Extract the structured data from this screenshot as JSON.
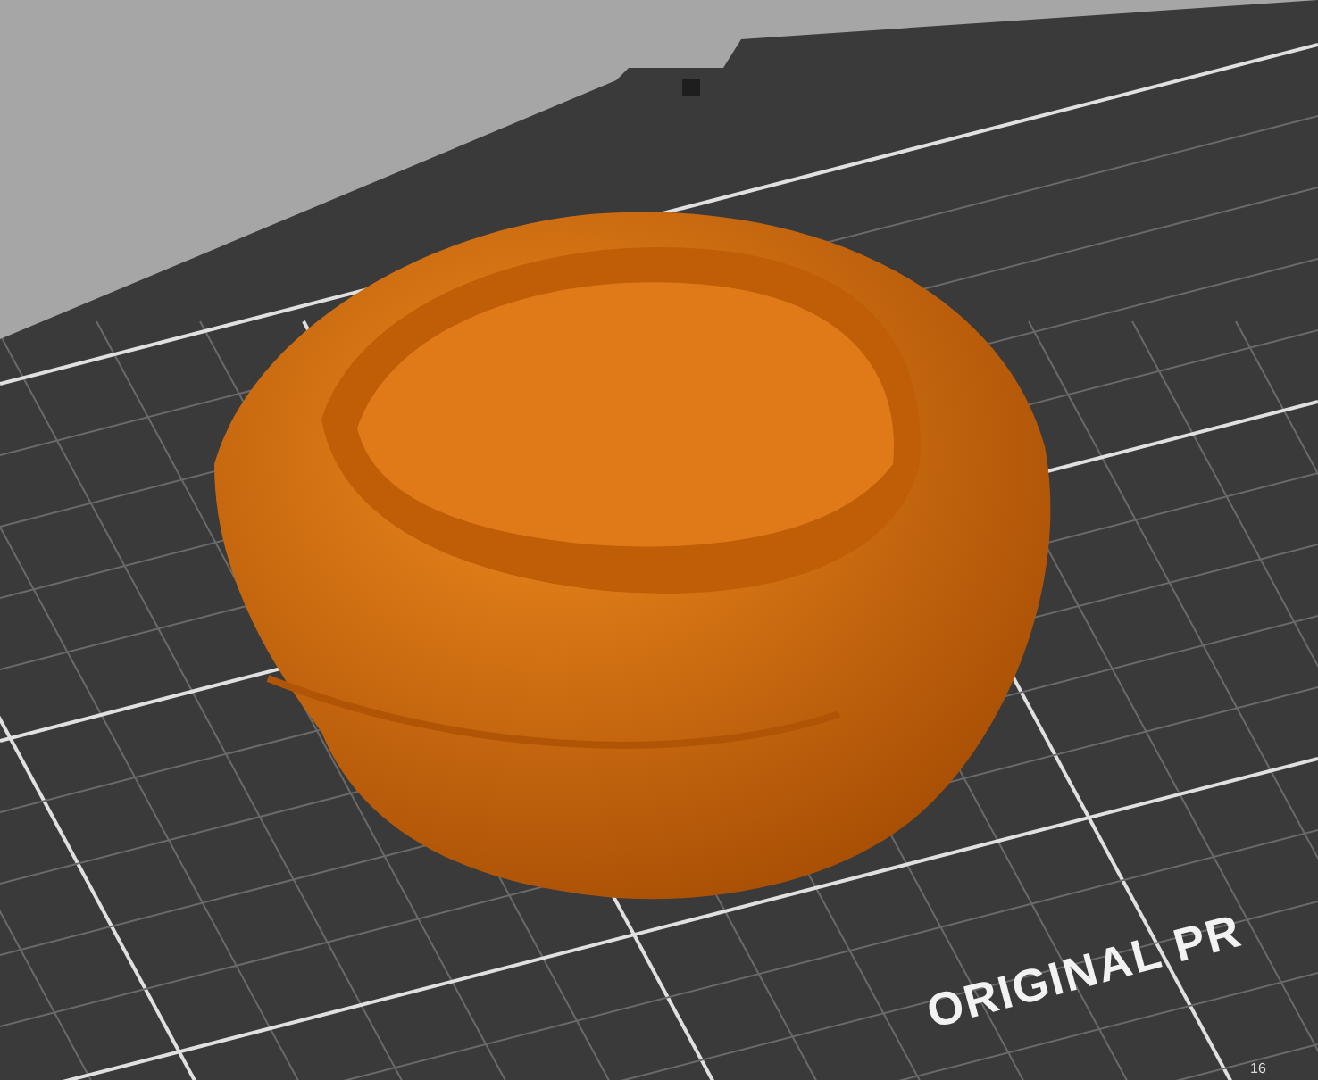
{
  "print_bed": {
    "label": "ORIGINAL PR",
    "scale_mark": "16"
  }
}
